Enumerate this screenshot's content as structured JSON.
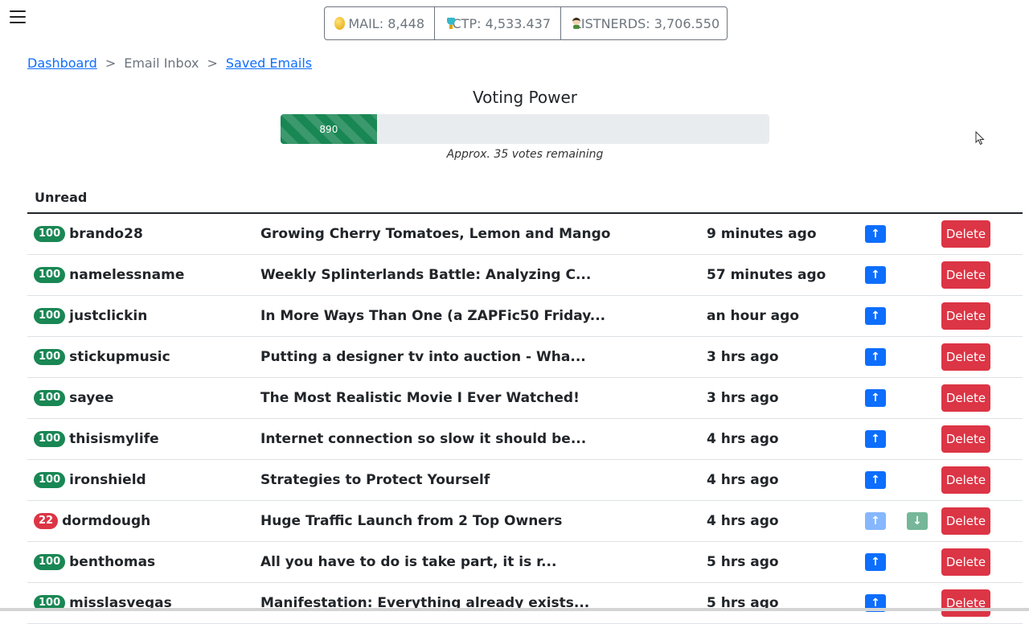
{
  "balances": [
    {
      "label": "MAIL: 8,448",
      "icon": "coins-icon"
    },
    {
      "label": "CTP: 4,533.437",
      "icon": "trophy-icon"
    },
    {
      "label": "LISTNERDS: 3,706.550",
      "icon": "nerd-icon"
    }
  ],
  "breadcrumb": {
    "dashboard": "Dashboard",
    "sep": ">",
    "inbox": "Email Inbox",
    "saved": "Saved Emails"
  },
  "voting": {
    "title": "Voting Power",
    "value": "890",
    "fill_percent": 19.7,
    "note": "Approx. 35 votes remaining"
  },
  "table": {
    "header": "Unread",
    "delete_label": "Delete",
    "rows": [
      {
        "score": "100",
        "score_color": "#198754",
        "user": "brando28",
        "subject": "Growing Cherry Tomatoes, Lemon and Mango",
        "time": "9 minutes ago",
        "voted": false
      },
      {
        "score": "100",
        "score_color": "#198754",
        "user": "namelessname",
        "subject": "Weekly Splinterlands Battle: Analyzing C...",
        "time": "57 minutes ago",
        "voted": false
      },
      {
        "score": "100",
        "score_color": "#198754",
        "user": "justclickin",
        "subject": "In More Ways Than One (a ZAPFic50 Friday...",
        "time": "an hour ago",
        "voted": false
      },
      {
        "score": "100",
        "score_color": "#198754",
        "user": "stickupmusic",
        "subject": "Putting a designer tv into auction - Wha...",
        "time": "3 hrs ago",
        "voted": false
      },
      {
        "score": "100",
        "score_color": "#198754",
        "user": "sayee",
        "subject": "The Most Realistic Movie I Ever Watched!",
        "time": "3 hrs ago",
        "voted": false
      },
      {
        "score": "100",
        "score_color": "#198754",
        "user": "thisismylife",
        "subject": "Internet connection so slow it should be...",
        "time": "4 hrs ago",
        "voted": false
      },
      {
        "score": "100",
        "score_color": "#198754",
        "user": "ironshield",
        "subject": "Strategies to Protect Yourself",
        "time": "4 hrs ago",
        "voted": false
      },
      {
        "score": "22",
        "score_color": "#dc3545",
        "user": "dormdough",
        "subject": "Huge Traffic Launch from 2 Top Owners",
        "time": "4 hrs ago",
        "voted": true
      },
      {
        "score": "100",
        "score_color": "#198754",
        "user": "benthomas",
        "subject": "All you have to do is take part, it is r...",
        "time": "5 hrs ago",
        "voted": false
      },
      {
        "score": "100",
        "score_color": "#198754",
        "user": "misslasvegas",
        "subject": "Manifestation: Everything already exists...",
        "time": "5 hrs ago",
        "voted": false
      }
    ]
  }
}
